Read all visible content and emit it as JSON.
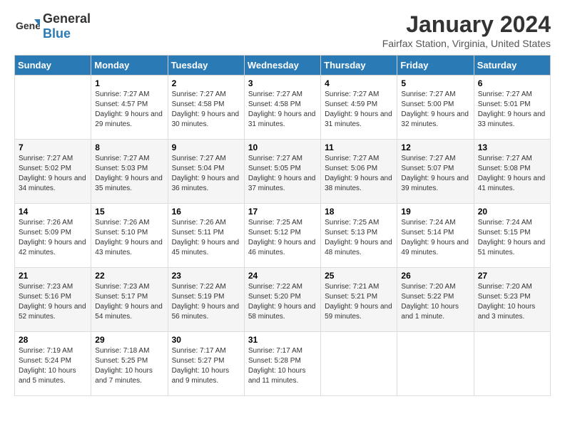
{
  "header": {
    "logo_general": "General",
    "logo_blue": "Blue",
    "month_year": "January 2024",
    "location": "Fairfax Station, Virginia, United States"
  },
  "columns": [
    "Sunday",
    "Monday",
    "Tuesday",
    "Wednesday",
    "Thursday",
    "Friday",
    "Saturday"
  ],
  "weeks": [
    [
      {
        "day": "",
        "empty": true
      },
      {
        "day": "1",
        "sunrise": "7:27 AM",
        "sunset": "4:57 PM",
        "daylight": "9 hours and 29 minutes."
      },
      {
        "day": "2",
        "sunrise": "7:27 AM",
        "sunset": "4:58 PM",
        "daylight": "9 hours and 30 minutes."
      },
      {
        "day": "3",
        "sunrise": "7:27 AM",
        "sunset": "4:58 PM",
        "daylight": "9 hours and 31 minutes."
      },
      {
        "day": "4",
        "sunrise": "7:27 AM",
        "sunset": "4:59 PM",
        "daylight": "9 hours and 31 minutes."
      },
      {
        "day": "5",
        "sunrise": "7:27 AM",
        "sunset": "5:00 PM",
        "daylight": "9 hours and 32 minutes."
      },
      {
        "day": "6",
        "sunrise": "7:27 AM",
        "sunset": "5:01 PM",
        "daylight": "9 hours and 33 minutes."
      }
    ],
    [
      {
        "day": "7",
        "sunrise": "7:27 AM",
        "sunset": "5:02 PM",
        "daylight": "9 hours and 34 minutes."
      },
      {
        "day": "8",
        "sunrise": "7:27 AM",
        "sunset": "5:03 PM",
        "daylight": "9 hours and 35 minutes."
      },
      {
        "day": "9",
        "sunrise": "7:27 AM",
        "sunset": "5:04 PM",
        "daylight": "9 hours and 36 minutes."
      },
      {
        "day": "10",
        "sunrise": "7:27 AM",
        "sunset": "5:05 PM",
        "daylight": "9 hours and 37 minutes."
      },
      {
        "day": "11",
        "sunrise": "7:27 AM",
        "sunset": "5:06 PM",
        "daylight": "9 hours and 38 minutes."
      },
      {
        "day": "12",
        "sunrise": "7:27 AM",
        "sunset": "5:07 PM",
        "daylight": "9 hours and 39 minutes."
      },
      {
        "day": "13",
        "sunrise": "7:27 AM",
        "sunset": "5:08 PM",
        "daylight": "9 hours and 41 minutes."
      }
    ],
    [
      {
        "day": "14",
        "sunrise": "7:26 AM",
        "sunset": "5:09 PM",
        "daylight": "9 hours and 42 minutes."
      },
      {
        "day": "15",
        "sunrise": "7:26 AM",
        "sunset": "5:10 PM",
        "daylight": "9 hours and 43 minutes."
      },
      {
        "day": "16",
        "sunrise": "7:26 AM",
        "sunset": "5:11 PM",
        "daylight": "9 hours and 45 minutes."
      },
      {
        "day": "17",
        "sunrise": "7:25 AM",
        "sunset": "5:12 PM",
        "daylight": "9 hours and 46 minutes."
      },
      {
        "day": "18",
        "sunrise": "7:25 AM",
        "sunset": "5:13 PM",
        "daylight": "9 hours and 48 minutes."
      },
      {
        "day": "19",
        "sunrise": "7:24 AM",
        "sunset": "5:14 PM",
        "daylight": "9 hours and 49 minutes."
      },
      {
        "day": "20",
        "sunrise": "7:24 AM",
        "sunset": "5:15 PM",
        "daylight": "9 hours and 51 minutes."
      }
    ],
    [
      {
        "day": "21",
        "sunrise": "7:23 AM",
        "sunset": "5:16 PM",
        "daylight": "9 hours and 52 minutes."
      },
      {
        "day": "22",
        "sunrise": "7:23 AM",
        "sunset": "5:17 PM",
        "daylight": "9 hours and 54 minutes."
      },
      {
        "day": "23",
        "sunrise": "7:22 AM",
        "sunset": "5:19 PM",
        "daylight": "9 hours and 56 minutes."
      },
      {
        "day": "24",
        "sunrise": "7:22 AM",
        "sunset": "5:20 PM",
        "daylight": "9 hours and 58 minutes."
      },
      {
        "day": "25",
        "sunrise": "7:21 AM",
        "sunset": "5:21 PM",
        "daylight": "9 hours and 59 minutes."
      },
      {
        "day": "26",
        "sunrise": "7:20 AM",
        "sunset": "5:22 PM",
        "daylight": "10 hours and 1 minute."
      },
      {
        "day": "27",
        "sunrise": "7:20 AM",
        "sunset": "5:23 PM",
        "daylight": "10 hours and 3 minutes."
      }
    ],
    [
      {
        "day": "28",
        "sunrise": "7:19 AM",
        "sunset": "5:24 PM",
        "daylight": "10 hours and 5 minutes."
      },
      {
        "day": "29",
        "sunrise": "7:18 AM",
        "sunset": "5:25 PM",
        "daylight": "10 hours and 7 minutes."
      },
      {
        "day": "30",
        "sunrise": "7:17 AM",
        "sunset": "5:27 PM",
        "daylight": "10 hours and 9 minutes."
      },
      {
        "day": "31",
        "sunrise": "7:17 AM",
        "sunset": "5:28 PM",
        "daylight": "10 hours and 11 minutes."
      },
      {
        "day": "",
        "empty": true
      },
      {
        "day": "",
        "empty": true
      },
      {
        "day": "",
        "empty": true
      }
    ]
  ]
}
